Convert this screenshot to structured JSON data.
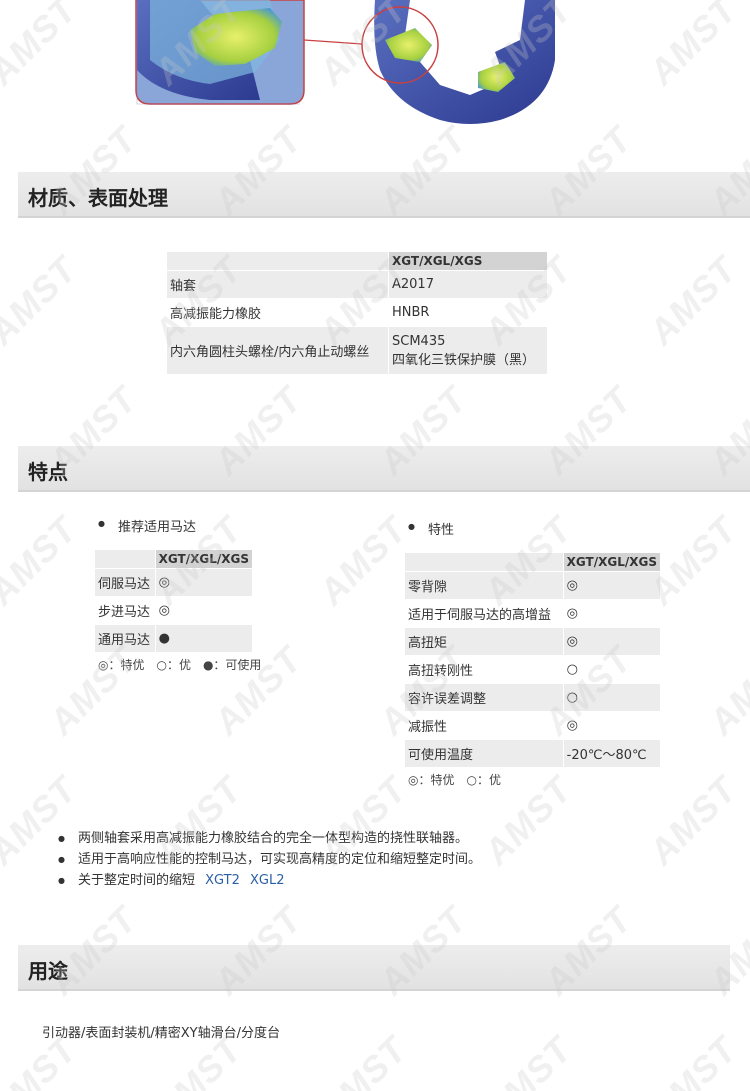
{
  "material_section": {
    "title": "材质、表面处理",
    "header": "XGT/XGL/XGS",
    "rows": [
      {
        "part": "轴套",
        "material": "A2017"
      },
      {
        "part": "高减振能力橡胶",
        "material": "HNBR"
      },
      {
        "part": "内六角圆柱头螺栓/内六角止动螺丝",
        "material_line1": "SCM435",
        "material_line2": "四氧化三铁保护膜（黑）"
      }
    ]
  },
  "features_section": {
    "title": "特点",
    "motor": {
      "bullet": "推荐适用马达",
      "header": "XGT/XGL/XGS",
      "rows": [
        {
          "label": "伺服马达",
          "value": "◎"
        },
        {
          "label": "步进马达",
          "value": "◎"
        },
        {
          "label": "通用马达",
          "value": "●"
        }
      ],
      "legend": "◎：特优　○：优　●：可使用"
    },
    "characteristics": {
      "bullet": "特性",
      "header": "XGT/XGL/XGS",
      "rows": [
        {
          "label": "零背隙",
          "value": "◎"
        },
        {
          "label": "适用于伺服马达的高增益",
          "value": "◎"
        },
        {
          "label": "高扭矩",
          "value": "◎"
        },
        {
          "label": "高扭转刚性",
          "value": "○"
        },
        {
          "label": "容许误差调整",
          "value": "○"
        },
        {
          "label": "减振性",
          "value": "◎"
        },
        {
          "label": "可使用温度",
          "value": "-20℃～80℃"
        }
      ],
      "legend": "◎：特优　○：优"
    },
    "list": [
      "两侧轴套采用高减振能力橡胶结合的完全一体型构造的挠性联轴器。",
      "适用于高响应性能的控制马达，可实现高精度的定位和缩短整定时间。",
      "关于整定时间的缩短"
    ],
    "links": [
      "XGT2",
      "XGL2"
    ]
  },
  "usage_section": {
    "title": "用途",
    "text": "引动器/表面封装机/精密XY轴滑台/分度台"
  },
  "watermark": "AMST",
  "colors": {
    "fem_blue": "#3a4fa8",
    "fem_yellow": "#d8e84a",
    "callout_red": "#d84a4a",
    "link": "#2a5fa5"
  }
}
